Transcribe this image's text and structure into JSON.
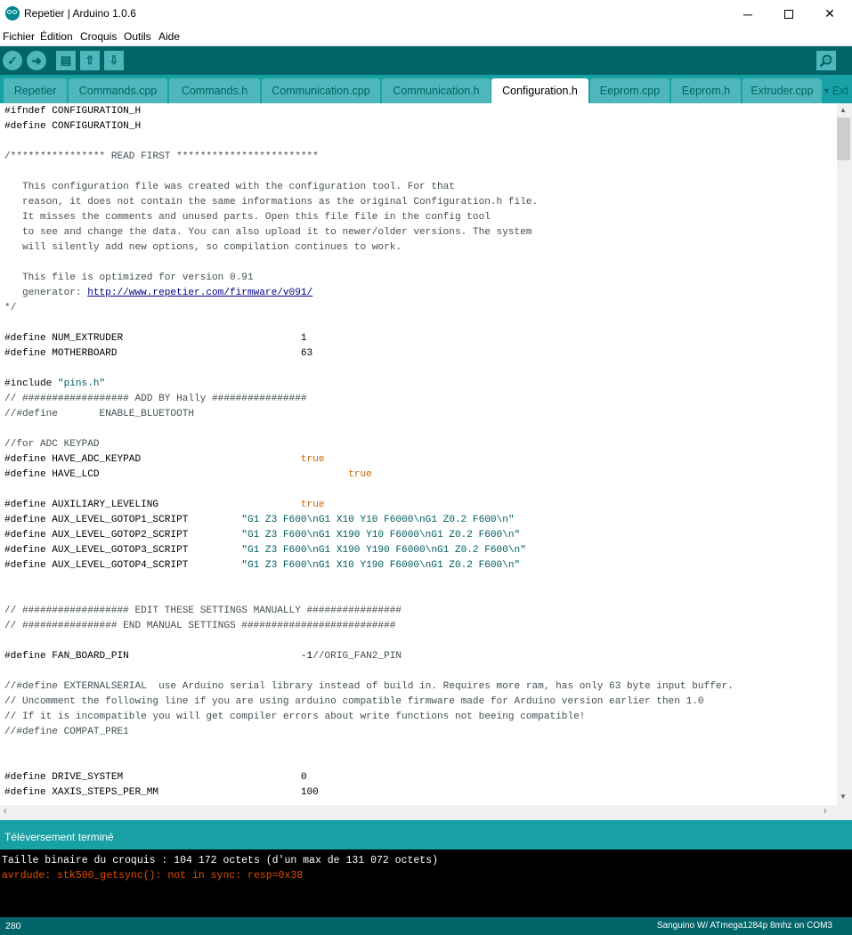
{
  "window": {
    "title": "Repetier | Arduino 1.0.6",
    "minimize": "─",
    "close": "✕"
  },
  "menu": [
    "Fichier",
    "Édition",
    "Croquis",
    "Outils",
    "Aide"
  ],
  "toolbar": {
    "buttons": [
      {
        "icon": "verify-icon",
        "glyph": "✓"
      },
      {
        "icon": "upload-icon",
        "glyph": "➜"
      },
      {
        "icon": "new-icon",
        "glyph": "▤"
      },
      {
        "icon": "open-icon",
        "glyph": "⇧"
      },
      {
        "icon": "save-icon",
        "glyph": "⇩"
      }
    ],
    "monitor_icon": "serial-monitor-icon"
  },
  "tabs": {
    "items": [
      "Repetier",
      "Commands.cpp",
      "Commands.h",
      "Communication.cpp",
      "Communication.h",
      "Configuration.h",
      "Eeprom.cpp",
      "Eeprom.h",
      "Extruder.cpp"
    ],
    "active": "Configuration.h",
    "more_label": "Ext"
  },
  "editor": {
    "lines": [
      [
        {
          "t": "#ifndef CONFIGURATION_H",
          "c": "kw"
        }
      ],
      [
        {
          "t": "#define CONFIGURATION_H",
          "c": "kw"
        }
      ],
      [],
      [
        {
          "t": "/**************** READ FIRST ************************",
          "c": "cmt"
        }
      ],
      [],
      [
        {
          "t": "   This configuration file was created with the configuration tool. For that",
          "c": "cmt"
        }
      ],
      [
        {
          "t": "   reason, it does not contain the same informations as the original Configuration.h file.",
          "c": "cmt"
        }
      ],
      [
        {
          "t": "   It misses the comments and unused parts. Open this file file in the config tool",
          "c": "cmt"
        }
      ],
      [
        {
          "t": "   to see and change the data. You can also upload it to newer/older versions. The system",
          "c": "cmt"
        }
      ],
      [
        {
          "t": "   will silently add new options, so compilation continues to work.",
          "c": "cmt"
        }
      ],
      [],
      [
        {
          "t": "   This file is optimized for version 0.91",
          "c": "cmt"
        }
      ],
      [
        {
          "t": "   generator: ",
          "c": "cmt"
        },
        {
          "t": "http://www.repetier.com/firmware/v091/",
          "c": "link"
        }
      ],
      [
        {
          "t": "*/",
          "c": "cmt"
        }
      ],
      [],
      [
        {
          "t": "#define NUM_EXTRUDER                              1",
          "c": "kw"
        }
      ],
      [
        {
          "t": "#define MOTHERBOARD                               63",
          "c": "kw"
        }
      ],
      [],
      [
        {
          "t": "#include ",
          "c": "kw"
        },
        {
          "t": "\"pins.h\"",
          "c": "str"
        }
      ],
      [
        {
          "t": "// ################## ADD BY Hally ################",
          "c": "cmt"
        }
      ],
      [
        {
          "t": "//#define       ENABLE_BLUETOOTH",
          "c": "cmt"
        }
      ],
      [],
      [
        {
          "t": "//for ADC KEYPAD",
          "c": "cmt"
        }
      ],
      [
        {
          "t": "#define HAVE_ADC_KEYPAD                           ",
          "c": "kw"
        },
        {
          "t": "true",
          "c": "lit"
        }
      ],
      [
        {
          "t": "#define HAVE_LCD                                          ",
          "c": "kw"
        },
        {
          "t": "true",
          "c": "lit"
        }
      ],
      [],
      [
        {
          "t": "#define AUXILIARY_LEVELING                        ",
          "c": "kw"
        },
        {
          "t": "true",
          "c": "lit"
        }
      ],
      [
        {
          "t": "#define AUX_LEVEL_GOTOP1_SCRIPT         ",
          "c": "kw"
        },
        {
          "t": "\"G1 Z3 F600\\nG1 X10 Y10 F6000\\nG1 Z0.2 F600\\n\"",
          "c": "str"
        }
      ],
      [
        {
          "t": "#define AUX_LEVEL_GOTOP2_SCRIPT         ",
          "c": "kw"
        },
        {
          "t": "\"G1 Z3 F600\\nG1 X190 Y10 F6000\\nG1 Z0.2 F600\\n\"",
          "c": "str"
        }
      ],
      [
        {
          "t": "#define AUX_LEVEL_GOTOP3_SCRIPT         ",
          "c": "kw"
        },
        {
          "t": "\"G1 Z3 F600\\nG1 X190 Y190 F6000\\nG1 Z0.2 F600\\n\"",
          "c": "str"
        }
      ],
      [
        {
          "t": "#define AUX_LEVEL_GOTOP4_SCRIPT         ",
          "c": "kw"
        },
        {
          "t": "\"G1 Z3 F600\\nG1 X10 Y190 F6000\\nG1 Z0.2 F600\\n\"",
          "c": "str"
        }
      ],
      [],
      [],
      [
        {
          "t": "// ################## EDIT THESE SETTINGS MANUALLY ################",
          "c": "cmt"
        }
      ],
      [
        {
          "t": "// ################ END MANUAL SETTINGS ##########################",
          "c": "cmt"
        }
      ],
      [],
      [
        {
          "t": "#define FAN_BOARD_PIN                             -1",
          "c": "kw"
        },
        {
          "t": "//ORIG_FAN2_PIN",
          "c": "cmt"
        }
      ],
      [],
      [
        {
          "t": "//#define EXTERNALSERIAL  use Arduino serial library instead of build in. Requires more ram, has only 63 byte input buffer.",
          "c": "cmt"
        }
      ],
      [
        {
          "t": "// Uncomment the following line if you are using arduino compatible firmware made for Arduino version earlier then 1.0",
          "c": "cmt"
        }
      ],
      [
        {
          "t": "// If it is incompatible you will get compiler errors about write functions not beeing compatible!",
          "c": "cmt"
        }
      ],
      [
        {
          "t": "//#define COMPAT_PRE1",
          "c": "cmt"
        }
      ],
      [],
      [],
      [
        {
          "t": "#define DRIVE_SYSTEM                              0",
          "c": "kw"
        }
      ],
      [
        {
          "t": "#define XAXIS_STEPS_PER_MM                        100",
          "c": "kw"
        }
      ]
    ]
  },
  "status": {
    "message": "Téléversement terminé"
  },
  "console": {
    "line1": "Taille binaire du croquis : 104 172 octets (d'un max de 131 072 octets)",
    "line2": "avrdude: stk500_getsync(): not in sync: resp=0x38"
  },
  "footer": {
    "line_number": "280",
    "board": "Sanguino W/ ATmega1284p 8mhz on COM3"
  },
  "colors": {
    "teal_dark": "#006468",
    "teal_mid": "#17a1a5",
    "teal_light": "#4db7bb",
    "error": "#e34c00"
  }
}
